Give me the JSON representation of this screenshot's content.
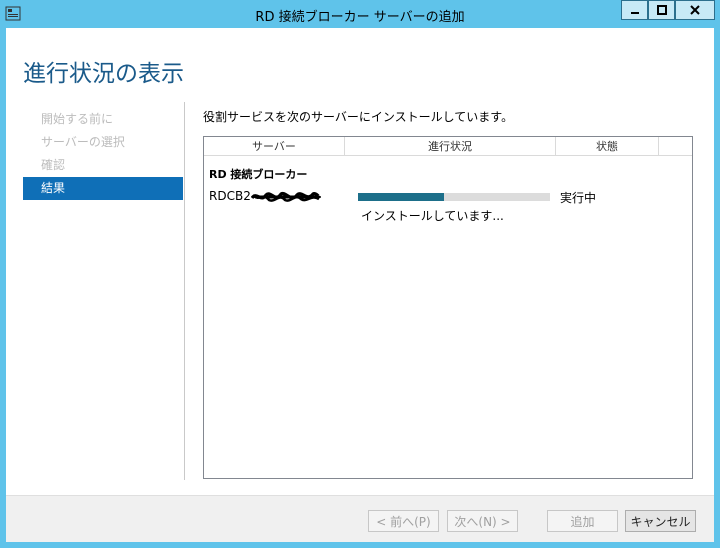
{
  "window": {
    "title": "RD 接続ブローカー サーバーの追加"
  },
  "page": {
    "title": "進行状況の表示"
  },
  "nav": {
    "items": [
      "開始する前に",
      "サーバーの選択",
      "確認",
      "結果"
    ],
    "active_index": 3
  },
  "content": {
    "description": "役割サービスを次のサーバーにインストールしています。",
    "columns": {
      "server": "サーバー",
      "progress": "進行状況",
      "status": "状態"
    },
    "role": "RD 接続ブローカー",
    "row": {
      "server_prefix": "RDCB2",
      "progress_fraction": 0.45,
      "status": "実行中",
      "message": "インストールしています..."
    }
  },
  "buttons": {
    "prev": "< 前へ(P)",
    "next": "次へ(N) >",
    "add": "追加",
    "cancel": "キャンセル"
  },
  "colors": {
    "frame": "#5fc3ea",
    "accent": "#0f6fb7",
    "progress": "#1d6f8a"
  }
}
